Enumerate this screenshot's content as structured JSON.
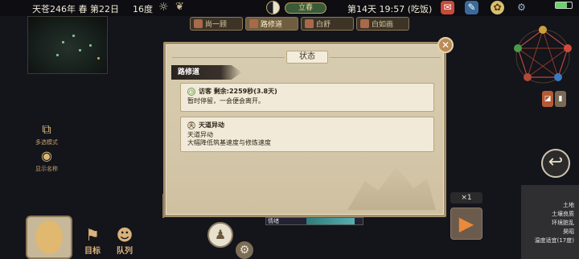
{
  "status_bar": {
    "date": "天苍246年 春 第22日",
    "temperature": "16度",
    "season_label": "立春",
    "day_time": "第14天 19:57 (吃饭)"
  },
  "character_tabs": [
    {
      "label": "尚一顾"
    },
    {
      "label": "路修道"
    },
    {
      "label": "白舒"
    },
    {
      "label": "白如画"
    }
  ],
  "left_buttons": [
    {
      "label": "多选模式",
      "icon": "multi-select-icon"
    },
    {
      "label": "显示名称",
      "icon": "show-name-icon"
    }
  ],
  "bottom_bar": {
    "target_label": "目标",
    "team_label": "队列",
    "mood_label": "情绪",
    "speed_label": "×1"
  },
  "environment": {
    "lines": [
      "土地",
      "土壤良质",
      "环境脏乱",
      "昊昭",
      "温度适宜(17度)"
    ]
  },
  "dialog": {
    "title": "状态",
    "character_name": "路修道",
    "cards": [
      {
        "heading": "访客  剩余:2259秒(3.8天)",
        "body": "暂时停留，一会便会离开。",
        "icon": "clock-icon"
      },
      {
        "heading": "天道异动",
        "body_lines": [
          "天道异动",
          "大幅降低筑基速度与修炼速度"
        ],
        "icon": "sky-icon"
      }
    ]
  },
  "colors": {
    "dialog_bg": "#d8ccb0",
    "card_bg": "#f1ead9",
    "accent_orange": "#e98a3c",
    "tab_active": "#6e5d3e"
  }
}
